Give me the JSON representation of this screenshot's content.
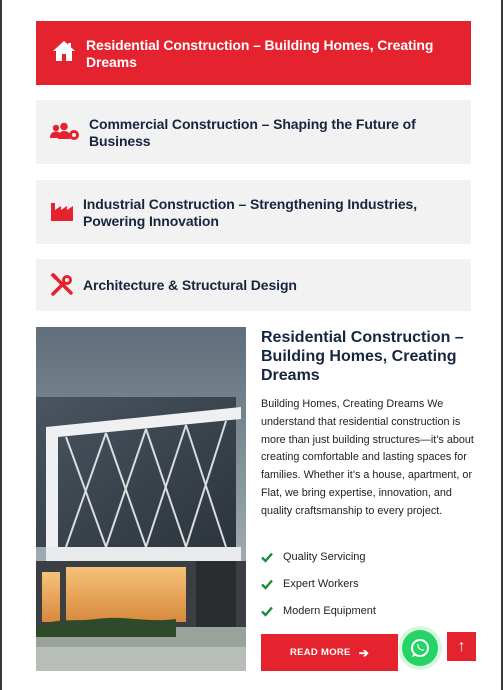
{
  "tabs": [
    {
      "label": "Residential Construction – Building Homes, Creating Dreams",
      "icon": "home-icon",
      "active": true
    },
    {
      "label": "Commercial Construction – Shaping the Future of Business",
      "icon": "users-gear-icon",
      "active": false
    },
    {
      "label": "Industrial Construction – Strengthening Industries, Powering Innovation",
      "icon": "factory-icon",
      "active": false
    },
    {
      "label": "Architecture & Structural Design",
      "icon": "tools-icon",
      "active": false
    }
  ],
  "content": {
    "title": "Residential Construction – Building Homes, Creating Dreams",
    "body": "Building Homes, Creating Dreams We understand that residential construction is more than just building structures—it’s about creating comfortable and lasting spaces for families. Whether it’s a house, apartment, or Flat, we bring expertise, innovation, and quality craftsmanship to every project.",
    "features": [
      "Quality Servicing",
      "Expert Workers",
      "Modern Equipment"
    ],
    "button_label": "READ MORE"
  },
  "colors": {
    "accent": "#e5232e",
    "navy": "#16263f",
    "tab_bg": "#f2f2f2",
    "check": "#1e8a3c",
    "whatsapp": "#25d366"
  },
  "floating": {
    "whatsapp_icon": "whatsapp-icon",
    "scroll_top_icon": "arrow-up-icon"
  }
}
